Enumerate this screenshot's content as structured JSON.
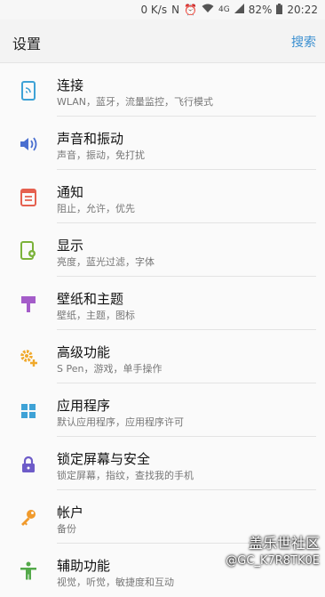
{
  "status_bar": {
    "speed": "0 K/s",
    "nfc": "N",
    "alarm": "⏰",
    "wifi": "WiFi",
    "network": "4G",
    "battery": "82%",
    "time": "20:22"
  },
  "header": {
    "title": "设置",
    "search": "搜索"
  },
  "items": [
    {
      "label": "连接",
      "sub": "WLAN，蓝牙，流量监控，飞行模式",
      "icon": "connection-icon",
      "color": "#3ea2d6"
    },
    {
      "label": "声音和振动",
      "sub": "声音，振动，免打扰",
      "icon": "sound-icon",
      "color": "#4a6fd0"
    },
    {
      "label": "通知",
      "sub": "阻止，允许，优先",
      "icon": "notification-icon",
      "color": "#e5604f"
    },
    {
      "label": "显示",
      "sub": "亮度，蓝光过滤，字体",
      "icon": "display-icon",
      "color": "#7bb23a"
    },
    {
      "label": "壁纸和主题",
      "sub": "壁纸，主题，图标",
      "icon": "wallpaper-icon",
      "color": "#a45cc9"
    },
    {
      "label": "高级功能",
      "sub": "S Pen，游戏，单手操作",
      "icon": "advanced-gear-icon",
      "color": "#f0a92c"
    },
    {
      "label": "应用程序",
      "sub": "默认应用程序，应用程序许可",
      "icon": "apps-icon",
      "color": "#3ea2d6"
    },
    {
      "label": "锁定屏幕与安全",
      "sub": "锁定屏幕，指纹，查找我的手机",
      "icon": "lock-icon",
      "color": "#6d5bc8"
    },
    {
      "label": "帐户",
      "sub": "备份",
      "icon": "key-icon",
      "color": "#f09a2c"
    },
    {
      "label": "辅助功能",
      "sub": "视觉，听觉，敏捷度和互动",
      "icon": "accessibility-icon",
      "color": "#54a94a"
    }
  ],
  "watermark": {
    "line1": "盖乐世社区",
    "line2": "@GC_K7R8TK0E"
  }
}
